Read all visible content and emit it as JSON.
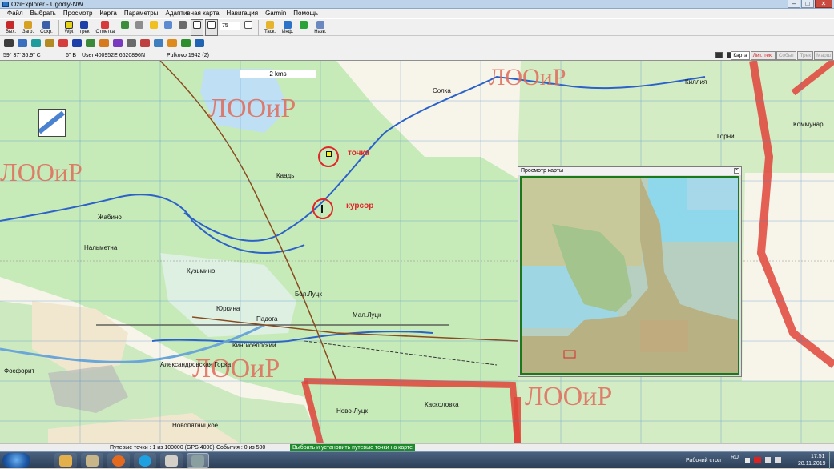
{
  "window": {
    "title": "OziExplorer - Ugodiy-NW",
    "btn_minimize": "–",
    "btn_maximize": "□",
    "btn_close": "✕"
  },
  "menu": [
    "Файл",
    "Выбрать",
    "Просмотр",
    "Карта",
    "Параметры",
    "Адаптивная карта",
    "Навигация",
    "Garmin",
    "Помощь"
  ],
  "toolbar1": {
    "load_label": "Загр.",
    "save_label": "Сохр.",
    "wpt_label": "Wpt",
    "track_label": "трек",
    "marks_label": "Отметка",
    "zoom_value": "75",
    "tasks_label": "Таск.",
    "info_label": "Инф.",
    "nav_label": "Назв.",
    "exit_label": "Вых."
  },
  "infobar": {
    "coord_lat": "59° 37' 36.9\" С",
    "coord_lon": "6\" В",
    "user_grid": "User 400952E  6620896N",
    "datum": "Pulkovo 1942 (2)",
    "tabs": [
      "Карта",
      "Лит. тек.",
      "Событ",
      "Трек",
      "Марш"
    ]
  },
  "map": {
    "scale_label": "2 kms",
    "poi_tochka": "точка",
    "poi_kursor": "курсор",
    "region_label": "ЛООиР",
    "towns": [
      "Жабино",
      "Нальметна",
      "Кингисеппский",
      "Юркина",
      "Падога",
      "Бол.Луцк",
      "Мал.Луцк",
      "Ново-Луцк",
      "Касколовка",
      "Александровская Горка",
      "Фосфорит",
      "Коммунар",
      "Киллия",
      "Горни",
      "Солка",
      "Каадь",
      "Кузьмино",
      "Новопятницкое"
    ]
  },
  "preview": {
    "title": "Просмотр карты",
    "close": "×"
  },
  "status": {
    "waypoints": "Путевые точки : 1 из 100000  (GPS:4000)",
    "events": "События : 0 из 500",
    "hint": "Выбрать и установить путевые точки на карте"
  },
  "taskbar": {
    "desktop_label": "Рабочий стол",
    "lang": "RU",
    "time": "17:51",
    "date": "28.11.2019",
    "apps": [
      "windows-explorer",
      "firefox",
      "skype",
      "calendar",
      "ozi-explorer"
    ]
  },
  "colors": {
    "map_green": "#c7eab9",
    "map_water": "#bfe0f4",
    "river": "#2b61c8",
    "boundary_red": "#e0443a",
    "poi_red": "#e02626"
  }
}
